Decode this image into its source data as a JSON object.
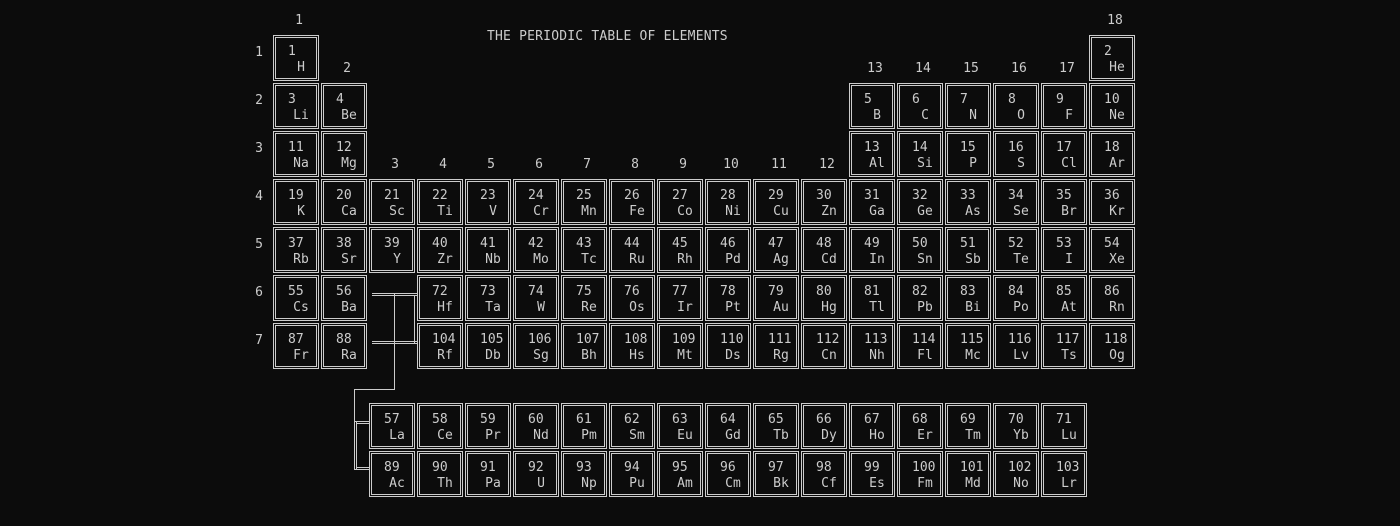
{
  "title": "THE PERIODIC TABLE OF ELEMENTS",
  "colors": {
    "background": "#0c0c0c",
    "foreground": "#cccccc"
  },
  "group_labels": [
    "1",
    "2",
    "3",
    "4",
    "5",
    "6",
    "7",
    "8",
    "9",
    "10",
    "11",
    "12",
    "13",
    "14",
    "15",
    "16",
    "17",
    "18"
  ],
  "period_labels": [
    "1",
    "2",
    "3",
    "4",
    "5",
    "6",
    "7"
  ],
  "main_elements": [
    {
      "n": "1",
      "s": "H",
      "period": 1,
      "group": 1
    },
    {
      "n": "2",
      "s": "He",
      "period": 1,
      "group": 18
    },
    {
      "n": "3",
      "s": "Li",
      "period": 2,
      "group": 1
    },
    {
      "n": "4",
      "s": "Be",
      "period": 2,
      "group": 2
    },
    {
      "n": "5",
      "s": "B",
      "period": 2,
      "group": 13
    },
    {
      "n": "6",
      "s": "C",
      "period": 2,
      "group": 14
    },
    {
      "n": "7",
      "s": "N",
      "period": 2,
      "group": 15
    },
    {
      "n": "8",
      "s": "O",
      "period": 2,
      "group": 16
    },
    {
      "n": "9",
      "s": "F",
      "period": 2,
      "group": 17
    },
    {
      "n": "10",
      "s": "Ne",
      "period": 2,
      "group": 18
    },
    {
      "n": "11",
      "s": "Na",
      "period": 3,
      "group": 1
    },
    {
      "n": "12",
      "s": "Mg",
      "period": 3,
      "group": 2
    },
    {
      "n": "13",
      "s": "Al",
      "period": 3,
      "group": 13
    },
    {
      "n": "14",
      "s": "Si",
      "period": 3,
      "group": 14
    },
    {
      "n": "15",
      "s": "P",
      "period": 3,
      "group": 15
    },
    {
      "n": "16",
      "s": "S",
      "period": 3,
      "group": 16
    },
    {
      "n": "17",
      "s": "Cl",
      "period": 3,
      "group": 17
    },
    {
      "n": "18",
      "s": "Ar",
      "period": 3,
      "group": 18
    },
    {
      "n": "19",
      "s": "K",
      "period": 4,
      "group": 1
    },
    {
      "n": "20",
      "s": "Ca",
      "period": 4,
      "group": 2
    },
    {
      "n": "21",
      "s": "Sc",
      "period": 4,
      "group": 3
    },
    {
      "n": "22",
      "s": "Ti",
      "period": 4,
      "group": 4
    },
    {
      "n": "23",
      "s": "V",
      "period": 4,
      "group": 5
    },
    {
      "n": "24",
      "s": "Cr",
      "period": 4,
      "group": 6
    },
    {
      "n": "25",
      "s": "Mn",
      "period": 4,
      "group": 7
    },
    {
      "n": "26",
      "s": "Fe",
      "period": 4,
      "group": 8
    },
    {
      "n": "27",
      "s": "Co",
      "period": 4,
      "group": 9
    },
    {
      "n": "28",
      "s": "Ni",
      "period": 4,
      "group": 10
    },
    {
      "n": "29",
      "s": "Cu",
      "period": 4,
      "group": 11
    },
    {
      "n": "30",
      "s": "Zn",
      "period": 4,
      "group": 12
    },
    {
      "n": "31",
      "s": "Ga",
      "period": 4,
      "group": 13
    },
    {
      "n": "32",
      "s": "Ge",
      "period": 4,
      "group": 14
    },
    {
      "n": "33",
      "s": "As",
      "period": 4,
      "group": 15
    },
    {
      "n": "34",
      "s": "Se",
      "period": 4,
      "group": 16
    },
    {
      "n": "35",
      "s": "Br",
      "period": 4,
      "group": 17
    },
    {
      "n": "36",
      "s": "Kr",
      "period": 4,
      "group": 18
    },
    {
      "n": "37",
      "s": "Rb",
      "period": 5,
      "group": 1
    },
    {
      "n": "38",
      "s": "Sr",
      "period": 5,
      "group": 2
    },
    {
      "n": "39",
      "s": "Y",
      "period": 5,
      "group": 3
    },
    {
      "n": "40",
      "s": "Zr",
      "period": 5,
      "group": 4
    },
    {
      "n": "41",
      "s": "Nb",
      "period": 5,
      "group": 5
    },
    {
      "n": "42",
      "s": "Mo",
      "period": 5,
      "group": 6
    },
    {
      "n": "43",
      "s": "Tc",
      "period": 5,
      "group": 7
    },
    {
      "n": "44",
      "s": "Ru",
      "period": 5,
      "group": 8
    },
    {
      "n": "45",
      "s": "Rh",
      "period": 5,
      "group": 9
    },
    {
      "n": "46",
      "s": "Pd",
      "period": 5,
      "group": 10
    },
    {
      "n": "47",
      "s": "Ag",
      "period": 5,
      "group": 11
    },
    {
      "n": "48",
      "s": "Cd",
      "period": 5,
      "group": 12
    },
    {
      "n": "49",
      "s": "In",
      "period": 5,
      "group": 13
    },
    {
      "n": "50",
      "s": "Sn",
      "period": 5,
      "group": 14
    },
    {
      "n": "51",
      "s": "Sb",
      "period": 5,
      "group": 15
    },
    {
      "n": "52",
      "s": "Te",
      "period": 5,
      "group": 16
    },
    {
      "n": "53",
      "s": "I",
      "period": 5,
      "group": 17
    },
    {
      "n": "54",
      "s": "Xe",
      "period": 5,
      "group": 18
    },
    {
      "n": "55",
      "s": "Cs",
      "period": 6,
      "group": 1
    },
    {
      "n": "56",
      "s": "Ba",
      "period": 6,
      "group": 2
    },
    {
      "n": "72",
      "s": "Hf",
      "period": 6,
      "group": 4
    },
    {
      "n": "73",
      "s": "Ta",
      "period": 6,
      "group": 5
    },
    {
      "n": "74",
      "s": "W",
      "period": 6,
      "group": 6
    },
    {
      "n": "75",
      "s": "Re",
      "period": 6,
      "group": 7
    },
    {
      "n": "76",
      "s": "Os",
      "period": 6,
      "group": 8
    },
    {
      "n": "77",
      "s": "Ir",
      "period": 6,
      "group": 9
    },
    {
      "n": "78",
      "s": "Pt",
      "period": 6,
      "group": 10
    },
    {
      "n": "79",
      "s": "Au",
      "period": 6,
      "group": 11
    },
    {
      "n": "80",
      "s": "Hg",
      "period": 6,
      "group": 12
    },
    {
      "n": "81",
      "s": "Tl",
      "period": 6,
      "group": 13
    },
    {
      "n": "82",
      "s": "Pb",
      "period": 6,
      "group": 14
    },
    {
      "n": "83",
      "s": "Bi",
      "period": 6,
      "group": 15
    },
    {
      "n": "84",
      "s": "Po",
      "period": 6,
      "group": 16
    },
    {
      "n": "85",
      "s": "At",
      "period": 6,
      "group": 17
    },
    {
      "n": "86",
      "s": "Rn",
      "period": 6,
      "group": 18
    },
    {
      "n": "87",
      "s": "Fr",
      "period": 7,
      "group": 1
    },
    {
      "n": "88",
      "s": "Ra",
      "period": 7,
      "group": 2
    },
    {
      "n": "104",
      "s": "Rf",
      "period": 7,
      "group": 4
    },
    {
      "n": "105",
      "s": "Db",
      "period": 7,
      "group": 5
    },
    {
      "n": "106",
      "s": "Sg",
      "period": 7,
      "group": 6
    },
    {
      "n": "107",
      "s": "Bh",
      "period": 7,
      "group": 7
    },
    {
      "n": "108",
      "s": "Hs",
      "period": 7,
      "group": 8
    },
    {
      "n": "109",
      "s": "Mt",
      "period": 7,
      "group": 9
    },
    {
      "n": "110",
      "s": "Ds",
      "period": 7,
      "group": 10
    },
    {
      "n": "111",
      "s": "Rg",
      "period": 7,
      "group": 11
    },
    {
      "n": "112",
      "s": "Cn",
      "period": 7,
      "group": 12
    },
    {
      "n": "113",
      "s": "Nh",
      "period": 7,
      "group": 13
    },
    {
      "n": "114",
      "s": "Fl",
      "period": 7,
      "group": 14
    },
    {
      "n": "115",
      "s": "Mc",
      "period": 7,
      "group": 15
    },
    {
      "n": "116",
      "s": "Lv",
      "period": 7,
      "group": 16
    },
    {
      "n": "117",
      "s": "Ts",
      "period": 7,
      "group": 17
    },
    {
      "n": "118",
      "s": "Og",
      "period": 7,
      "group": 18
    }
  ],
  "f_block": {
    "lanthanides": [
      {
        "n": "57",
        "s": "La"
      },
      {
        "n": "58",
        "s": "Ce"
      },
      {
        "n": "59",
        "s": "Pr"
      },
      {
        "n": "60",
        "s": "Nd"
      },
      {
        "n": "61",
        "s": "Pm"
      },
      {
        "n": "62",
        "s": "Sm"
      },
      {
        "n": "63",
        "s": "Eu"
      },
      {
        "n": "64",
        "s": "Gd"
      },
      {
        "n": "65",
        "s": "Tb"
      },
      {
        "n": "66",
        "s": "Dy"
      },
      {
        "n": "67",
        "s": "Ho"
      },
      {
        "n": "68",
        "s": "Er"
      },
      {
        "n": "69",
        "s": "Tm"
      },
      {
        "n": "70",
        "s": "Yb"
      },
      {
        "n": "71",
        "s": "Lu"
      }
    ],
    "actinides": [
      {
        "n": "89",
        "s": "Ac"
      },
      {
        "n": "90",
        "s": "Th"
      },
      {
        "n": "91",
        "s": "Pa"
      },
      {
        "n": "92",
        "s": "U"
      },
      {
        "n": "93",
        "s": "Np"
      },
      {
        "n": "94",
        "s": "Pu"
      },
      {
        "n": "95",
        "s": "Am"
      },
      {
        "n": "96",
        "s": "Cm"
      },
      {
        "n": "97",
        "s": "Bk"
      },
      {
        "n": "98",
        "s": "Cf"
      },
      {
        "n": "99",
        "s": "Es"
      },
      {
        "n": "100",
        "s": "Fm"
      },
      {
        "n": "101",
        "s": "Md"
      },
      {
        "n": "102",
        "s": "No"
      },
      {
        "n": "103",
        "s": "Lr"
      }
    ]
  }
}
